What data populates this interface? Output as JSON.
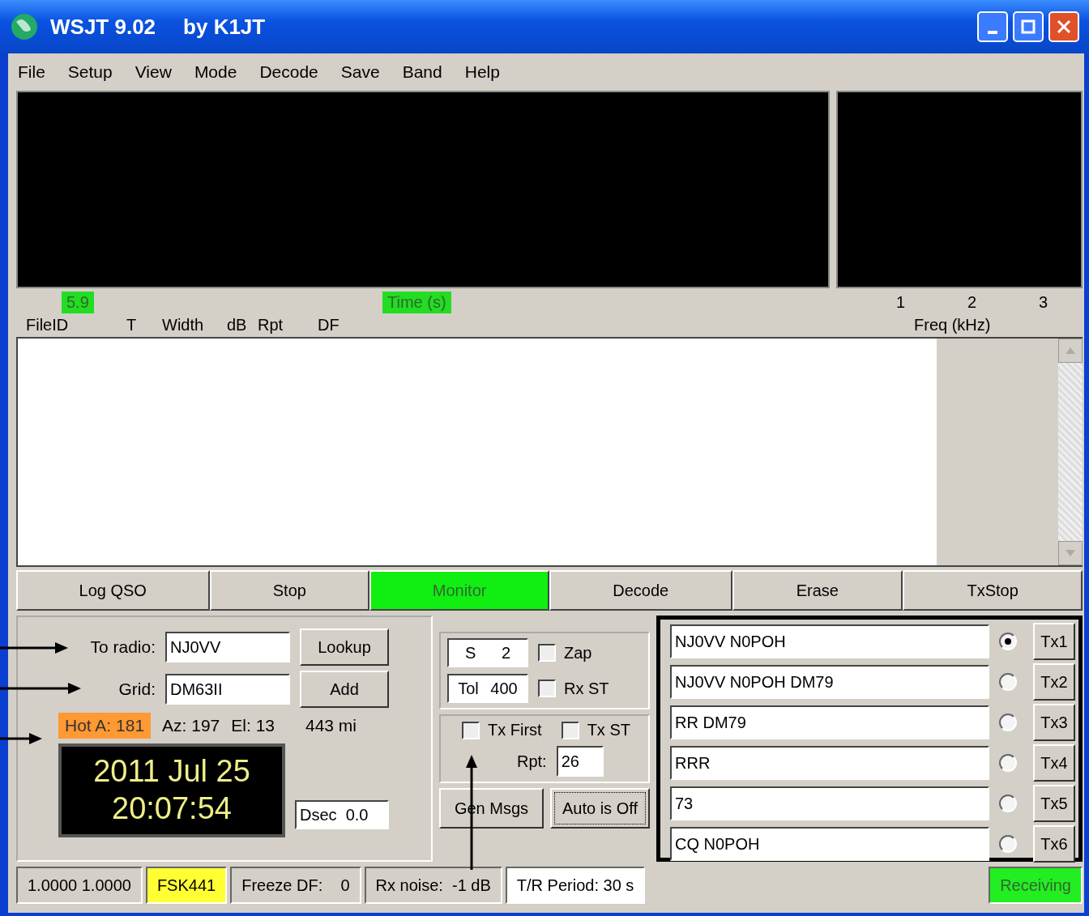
{
  "window": {
    "title": "WSJT 9.02",
    "author": "by K1JT"
  },
  "menu": [
    "File",
    "Setup",
    "View",
    "Mode",
    "Decode",
    "Save",
    "Band",
    "Help"
  ],
  "display": {
    "level_label": "5.9",
    "time_label": "Time (s)",
    "freq_ticks": [
      "1",
      "2",
      "3"
    ],
    "freq_label": "Freq (kHz)"
  },
  "columns": [
    "FileID",
    "T",
    "Width",
    "dB",
    "Rpt",
    "DF"
  ],
  "buttons": [
    {
      "label": "Log QSO",
      "on": false
    },
    {
      "label": "Stop",
      "on": false
    },
    {
      "label": "Monitor",
      "on": true
    },
    {
      "label": "Decode",
      "on": false
    },
    {
      "label": "Erase",
      "on": false
    },
    {
      "label": "TxStop",
      "on": false
    }
  ],
  "station": {
    "to_radio_label": "To radio:",
    "to_radio": "NJ0VV",
    "lookup": "Lookup",
    "grid_label": "Grid:",
    "grid": "DM63II",
    "add": "Add",
    "hot_a": "Hot A: 181",
    "az": "Az: 197",
    "el": "El: 13",
    "distance": "443 mi",
    "date": "2011 Jul 25",
    "time": "20:07:54",
    "dsec": "Dsec  0.0"
  },
  "settings": {
    "s_label": "S",
    "s_value": "2",
    "tol_label": "Tol",
    "tol_value": "400",
    "rpt_label": "Rpt:",
    "rpt": "26",
    "gen_msgs": "Gen Msgs",
    "auto": "Auto is Off"
  },
  "checkboxes": [
    {
      "label": "Zap",
      "checked": false
    },
    {
      "label": "Rx ST",
      "checked": false
    },
    {
      "label": "Tx First",
      "checked": false
    },
    {
      "label": "Tx ST",
      "checked": false
    }
  ],
  "messages": [
    {
      "text": "NJ0VV N0POH",
      "button": "Tx1",
      "selected": true
    },
    {
      "text": "NJ0VV N0POH DM79",
      "button": "Tx2",
      "selected": false
    },
    {
      "text": "RR DM79",
      "button": "Tx3",
      "selected": false
    },
    {
      "text": "RRR",
      "button": "Tx4",
      "selected": false
    },
    {
      "text": "73",
      "button": "Tx5",
      "selected": false
    },
    {
      "text": "CQ N0POH",
      "button": "Tx6",
      "selected": false
    }
  ],
  "status_bar": [
    {
      "text": "1.0000 1.0000"
    },
    {
      "text": "FSK441",
      "color": "#ffff33"
    },
    {
      "text": "Freeze DF:    0"
    },
    {
      "text": "Rx noise:  -1 dB"
    },
    {
      "text": "T/R Period: 30 s",
      "color": "#ffffff"
    },
    {
      "text": "Receiving",
      "color": "#22ee22"
    }
  ]
}
